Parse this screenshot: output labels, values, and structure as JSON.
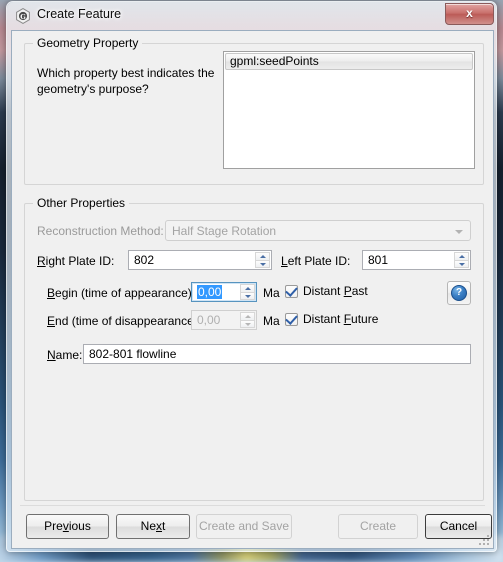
{
  "window": {
    "title": "Create Feature",
    "icon": "gplates-logo-icon",
    "close_label": "x"
  },
  "geometry_property": {
    "group_title": "Geometry Property",
    "question_line1": "Which property best indicates the",
    "question_line2": "geometry's purpose?",
    "list_items": [
      {
        "label": "gpml:seedPoints",
        "selected": true
      }
    ]
  },
  "other_properties": {
    "group_title": "Other Properties",
    "reconstruction_method": {
      "label": "Reconstruction Method:",
      "value": "Half Stage Rotation",
      "enabled": false
    },
    "right_plate_id": {
      "label_pre": "R",
      "label_accel": "",
      "label": "Right Plate ID:",
      "value": "802"
    },
    "left_plate_id": {
      "label": "Left Plate ID:",
      "value": "801"
    },
    "begin_time": {
      "label": "Begin (time of appearance):",
      "value": "0,00",
      "unit": "Ma",
      "checkbox_label": "Distant Past",
      "checkbox_checked": true,
      "selected": true
    },
    "end_time": {
      "label": "End (time of disappearance):",
      "value": "0,00",
      "unit": "Ma",
      "checkbox_label": "Distant Future",
      "checkbox_checked": true,
      "enabled": false
    },
    "name_field": {
      "label": "Name:",
      "value": "802-801 flowline"
    },
    "help_button": {
      "icon": "help-question-icon",
      "glyph": "?"
    }
  },
  "buttons": {
    "previous": {
      "label": "Previous",
      "enabled": true
    },
    "next": {
      "label": "Next",
      "enabled": true
    },
    "create_and_save": {
      "label": "Create and Save",
      "enabled": false
    },
    "create": {
      "label": "Create",
      "enabled": false
    },
    "cancel": {
      "label": "Cancel",
      "enabled": true,
      "default": true
    }
  },
  "colors": {
    "selection_blue": "#3399ff",
    "close_red": "#c9706c",
    "help_blue": "#3b7fc4",
    "client_bg": "#f0f0f0"
  }
}
